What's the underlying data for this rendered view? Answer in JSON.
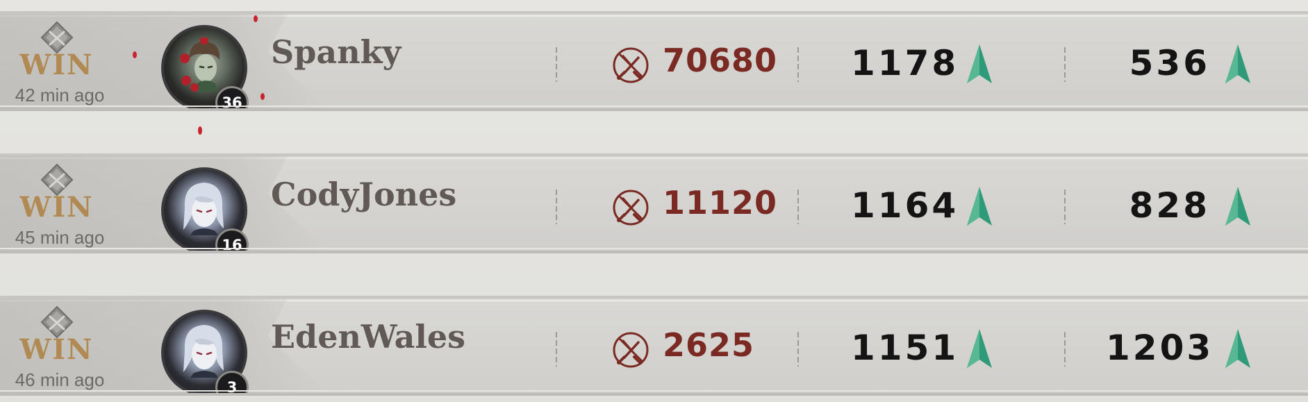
{
  "colors": {
    "win": "#b08a52",
    "damage": "#7a2a22",
    "name": "#605955",
    "stat": "#141414",
    "arrow": "#2f9a78"
  },
  "matches": [
    {
      "result": "WIN",
      "time": "42 min ago",
      "avatar": "thorn-frame-portrait",
      "level": "36",
      "name": "Spanky",
      "damage": "70680",
      "stat1": "1178",
      "stat1_trend": "up-arrow-icon",
      "stat2": "536",
      "stat2_trend": "up-arrow-icon"
    },
    {
      "result": "WIN",
      "time": "45 min ago",
      "avatar": "silver-hair-portrait",
      "level": "16",
      "name": "CodyJones",
      "damage": "11120",
      "stat1": "1164",
      "stat1_trend": "up-arrow-icon",
      "stat2": "828",
      "stat2_trend": "up-arrow-icon"
    },
    {
      "result": "WIN",
      "time": "46 min ago",
      "avatar": "silver-hair-portrait",
      "level": "3",
      "name": "EdenWales",
      "damage": "2625",
      "stat1": "1151",
      "stat1_trend": "up-arrow-icon",
      "stat2": "1203",
      "stat2_trend": "up-arrow-icon"
    }
  ]
}
